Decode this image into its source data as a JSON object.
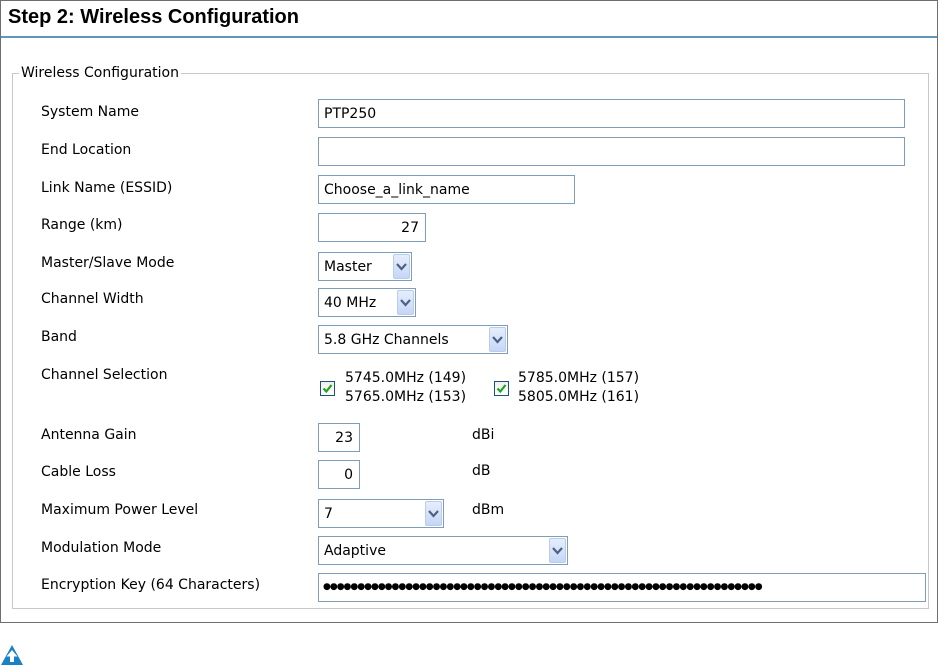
{
  "panel": {
    "title": "Step 2: Wireless Configuration"
  },
  "fieldset": {
    "legend": "Wireless Configuration"
  },
  "fields": {
    "system_name": {
      "label": "System Name",
      "value": "PTP250"
    },
    "end_location": {
      "label": "End Location",
      "value": ""
    },
    "link_name": {
      "label": "Link Name (ESSID)",
      "value": "Choose_a_link_name"
    },
    "range": {
      "label": "Range (km)",
      "value": "27"
    },
    "master_slave": {
      "label": "Master/Slave Mode",
      "value": "Master"
    },
    "channel_width": {
      "label": "Channel Width",
      "value": "40 MHz"
    },
    "band": {
      "label": "Band",
      "value": "5.8 GHz Channels"
    },
    "channel_selection": {
      "label": "Channel Selection",
      "groups": [
        {
          "checked": true,
          "line1": "5745.0MHz (149)",
          "line2": "5765.0MHz (153)"
        },
        {
          "checked": true,
          "line1": "5785.0MHz (157)",
          "line2": "5805.0MHz (161)"
        }
      ]
    },
    "antenna_gain": {
      "label": "Antenna Gain",
      "value": "23",
      "unit": "dBi"
    },
    "cable_loss": {
      "label": "Cable Loss",
      "value": "0",
      "unit": "dB"
    },
    "max_power": {
      "label": "Maximum Power Level",
      "value": "7",
      "unit": "dBm"
    },
    "modulation": {
      "label": "Modulation Mode",
      "value": "Adaptive"
    },
    "encryption_key": {
      "label": "Encryption Key (64 Characters)",
      "value": "●●●●●●●●●●●●●●●●●●●●●●●●●●●●●●●●●●●●●●●●●●●●●●●●●●●●●●●●●●●●●●●●"
    }
  },
  "icons": {
    "nav": "arrow-up-icon"
  },
  "colors": {
    "header_rule": "#5e97b8",
    "input_border": "#7f9db9",
    "check": "#21a121",
    "nav_icon": "#1a82c4"
  }
}
